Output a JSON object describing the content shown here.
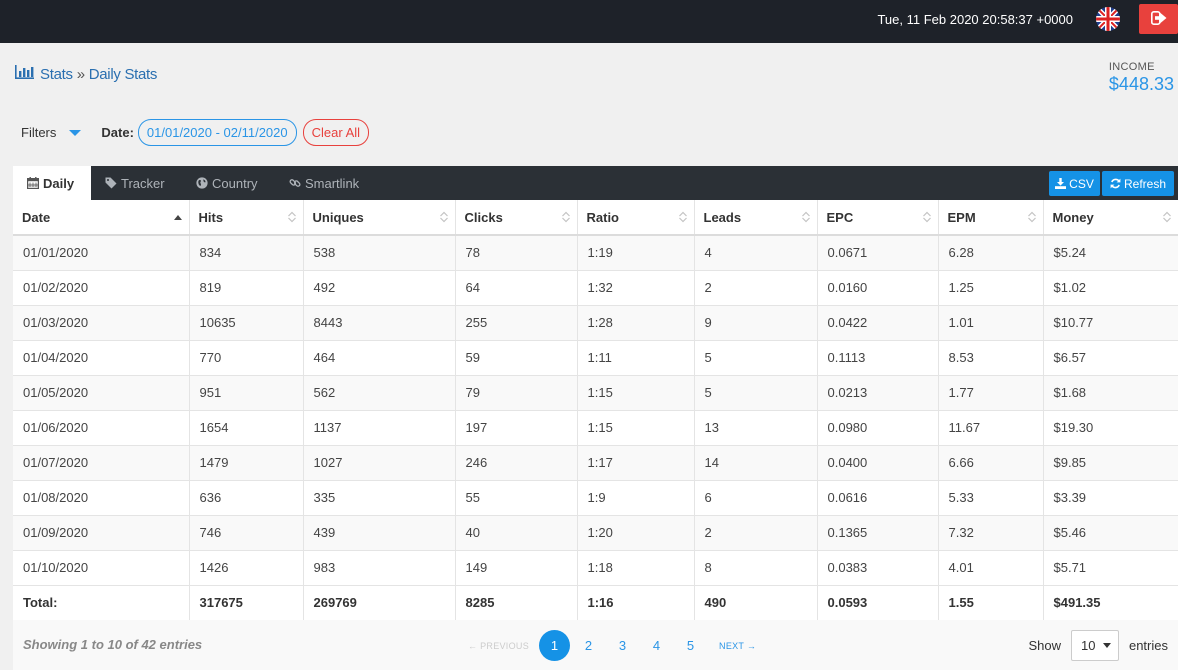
{
  "header": {
    "datetime": "Tue, 11 Feb 2020 20:58:37 +0000",
    "flag_icon": "uk-flag-icon",
    "logout_icon": "sign-out-icon",
    "logout_color": "#e8413d"
  },
  "breadcrumb": {
    "icon": "bar-chart-icon",
    "root": "Stats",
    "separator": "»",
    "current": "Daily Stats"
  },
  "income": {
    "label": "INCOME",
    "value": "$448.33"
  },
  "filters": {
    "label": "Filters",
    "date_label": "Date:",
    "date_range": "01/01/2020 - 02/11/2020",
    "clear_label": "Clear All"
  },
  "tabs": [
    {
      "label": "Daily",
      "icon": "calendar-icon",
      "active": true
    },
    {
      "label": "Tracker",
      "icon": "tag-icon",
      "active": false
    },
    {
      "label": "Country",
      "icon": "globe-icon",
      "active": false
    },
    {
      "label": "Smartlink",
      "icon": "link-icon",
      "active": false
    }
  ],
  "actions": {
    "csv": "CSV",
    "refresh": "Refresh",
    "accent": "#1592e6"
  },
  "table": {
    "columns": [
      "Date",
      "Hits",
      "Uniques",
      "Clicks",
      "Ratio",
      "Leads",
      "EPC",
      "EPM",
      "Money"
    ],
    "rows": [
      [
        "01/01/2020",
        "834",
        "538",
        "78",
        "1:19",
        "4",
        "0.0671",
        "6.28",
        "$5.24"
      ],
      [
        "01/02/2020",
        "819",
        "492",
        "64",
        "1:32",
        "2",
        "0.0160",
        "1.25",
        "$1.02"
      ],
      [
        "01/03/2020",
        "10635",
        "8443",
        "255",
        "1:28",
        "9",
        "0.0422",
        "1.01",
        "$10.77"
      ],
      [
        "01/04/2020",
        "770",
        "464",
        "59",
        "1:11",
        "5",
        "0.1113",
        "8.53",
        "$6.57"
      ],
      [
        "01/05/2020",
        "951",
        "562",
        "79",
        "1:15",
        "5",
        "0.0213",
        "1.77",
        "$1.68"
      ],
      [
        "01/06/2020",
        "1654",
        "1137",
        "197",
        "1:15",
        "13",
        "0.0980",
        "11.67",
        "$19.30"
      ],
      [
        "01/07/2020",
        "1479",
        "1027",
        "246",
        "1:17",
        "14",
        "0.0400",
        "6.66",
        "$9.85"
      ],
      [
        "01/08/2020",
        "636",
        "335",
        "55",
        "1:9",
        "6",
        "0.0616",
        "5.33",
        "$3.39"
      ],
      [
        "01/09/2020",
        "746",
        "439",
        "40",
        "1:20",
        "2",
        "0.1365",
        "7.32",
        "$5.46"
      ],
      [
        "01/10/2020",
        "1426",
        "983",
        "149",
        "1:18",
        "8",
        "0.0383",
        "4.01",
        "$5.71"
      ]
    ],
    "total": [
      "Total:",
      "317675",
      "269769",
      "8285",
      "1:16",
      "490",
      "0.0593",
      "1.55",
      "$491.35"
    ]
  },
  "footer": {
    "info": "Showing 1 to 10 of 42 entries",
    "prev": "← PREVIOUS",
    "next": "NEXT →",
    "pages": [
      "1",
      "2",
      "3",
      "4",
      "5"
    ],
    "active_page": "1",
    "show_label": "Show",
    "page_size": "10",
    "entries_label": "entries"
  }
}
